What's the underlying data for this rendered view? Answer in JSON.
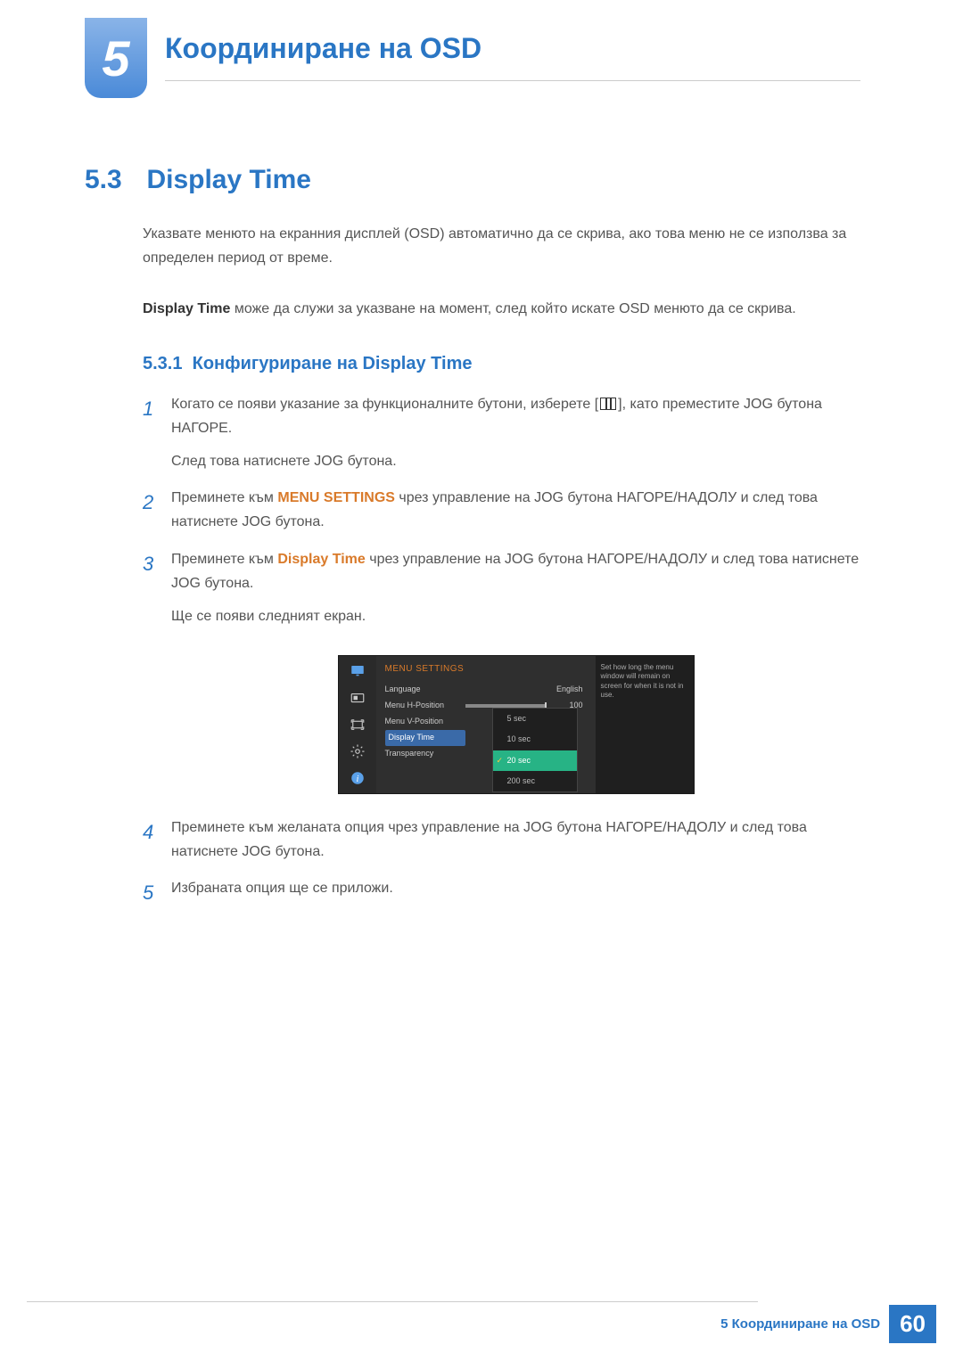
{
  "chapter": {
    "number": "5",
    "title": "Координиране на OSD"
  },
  "section": {
    "number": "5.3",
    "title": "Display Time"
  },
  "intro": {
    "p1": "Указвате менюто на екранния дисплей (OSD) автоматично да се скрива, ако това меню не се използва за определен период от време.",
    "p2_bold": "Display Time",
    "p2_rest": " може да служи за указване на момент, след който искате OSD менюто да се скрива."
  },
  "subsection": {
    "number": "5.3.1",
    "title": "Конфигуриране на Display Time"
  },
  "steps": {
    "s1": {
      "pre": "Когато се появи указание за функционалните бутони, изберете [",
      "post": "], като преместите JOG бутона НАГОРЕ.",
      "sub": "След това натиснете JOG бутона."
    },
    "s2": {
      "pre": "Преминете към ",
      "bold": "MENU SETTINGS",
      "post": " чрез управление на JOG бутона НАГОРЕ/НАДОЛУ и след това натиснете JOG бутона."
    },
    "s3": {
      "pre": "Преминете към ",
      "bold": "Display Time",
      "post": " чрез управление на JOG бутона НАГОРЕ/НАДОЛУ и след това натиснете JOG бутона.",
      "sub": "Ще се появи следният екран."
    },
    "s4": "Преминете към желаната опция чрез управление на JOG бутона НАГОРЕ/НАДОЛУ и след това натиснете JOG бутона.",
    "s5": "Избраната опция ще се приложи."
  },
  "osd": {
    "title": "MENU SETTINGS",
    "rows": {
      "language": {
        "label": "Language",
        "value": "English"
      },
      "hpos": {
        "label": "Menu H-Position",
        "value": "100"
      },
      "vpos": {
        "label": "Menu V-Position"
      },
      "displaytime": {
        "label": "Display Time"
      },
      "transparency": {
        "label": "Transparency"
      }
    },
    "options": [
      "5 sec",
      "10 sec",
      "20 sec",
      "200 sec"
    ],
    "selected_option": "20 sec",
    "help": "Set how long the menu window will remain on screen for when it is not in use."
  },
  "footer": {
    "text": "5 Координиране на OSD",
    "page": "60"
  }
}
